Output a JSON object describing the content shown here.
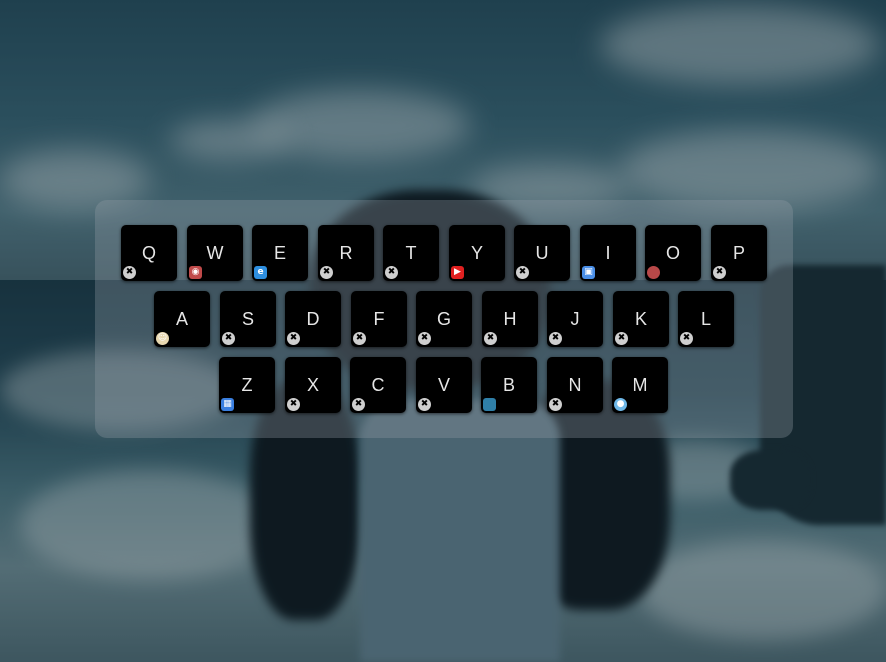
{
  "keyboard": {
    "rows": [
      {
        "keys": [
          {
            "letter": "Q",
            "icon": "clear-icon",
            "icon_color": "#cfcfcf"
          },
          {
            "letter": "W",
            "icon": "red-eye-icon",
            "icon_color": "#c04a4a"
          },
          {
            "letter": "E",
            "icon": "blue-e-icon",
            "icon_color": "#2e8fe0"
          },
          {
            "letter": "R",
            "icon": "clear-icon",
            "icon_color": "#cfcfcf"
          },
          {
            "letter": "T",
            "icon": "clear-icon",
            "icon_color": "#cfcfcf"
          },
          {
            "letter": "Y",
            "icon": "youtube-icon",
            "icon_color": "#e02020"
          },
          {
            "letter": "U",
            "icon": "clear-icon",
            "icon_color": "#cfcfcf"
          },
          {
            "letter": "I",
            "icon": "colorful-app-icon",
            "icon_color": "#4a8fe8"
          },
          {
            "letter": "O",
            "icon": "red-circle-icon",
            "icon_color": "#b84848"
          },
          {
            "letter": "P",
            "icon": "clear-icon",
            "icon_color": "#cfcfcf"
          }
        ]
      },
      {
        "keys": [
          {
            "letter": "A",
            "icon": "face-icon",
            "icon_color": "#e8d8b0"
          },
          {
            "letter": "S",
            "icon": "clear-icon",
            "icon_color": "#cfcfcf"
          },
          {
            "letter": "D",
            "icon": "clear-icon",
            "icon_color": "#cfcfcf"
          },
          {
            "letter": "F",
            "icon": "clear-icon",
            "icon_color": "#cfcfcf"
          },
          {
            "letter": "G",
            "icon": "clear-icon",
            "icon_color": "#cfcfcf"
          },
          {
            "letter": "H",
            "icon": "clear-icon",
            "icon_color": "#cfcfcf"
          },
          {
            "letter": "J",
            "icon": "clear-icon",
            "icon_color": "#cfcfcf"
          },
          {
            "letter": "K",
            "icon": "clear-icon",
            "icon_color": "#cfcfcf"
          },
          {
            "letter": "L",
            "icon": "clear-icon",
            "icon_color": "#cfcfcf"
          }
        ]
      },
      {
        "keys": [
          {
            "letter": "Z",
            "icon": "blue-grid-icon",
            "icon_color": "#3a7fe0"
          },
          {
            "letter": "X",
            "icon": "clear-icon",
            "icon_color": "#cfcfcf"
          },
          {
            "letter": "C",
            "icon": "clear-icon",
            "icon_color": "#cfcfcf"
          },
          {
            "letter": "V",
            "icon": "clear-icon",
            "icon_color": "#cfcfcf"
          },
          {
            "letter": "B",
            "icon": "teal-square-icon",
            "icon_color": "#2f7fa8"
          },
          {
            "letter": "N",
            "icon": "clear-icon",
            "icon_color": "#cfcfcf"
          },
          {
            "letter": "M",
            "icon": "chat-bubble-icon",
            "icon_color": "#6fb8e8"
          }
        ]
      }
    ]
  }
}
